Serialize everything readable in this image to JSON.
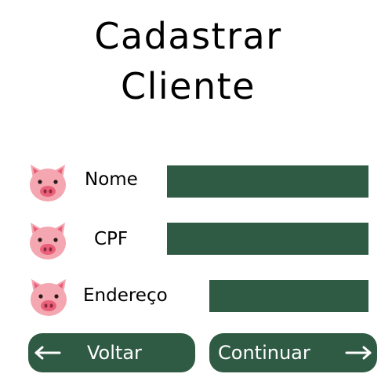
{
  "header": {
    "title_line1": "Cadastrar",
    "title_line2": "Cliente"
  },
  "form": {
    "fields": [
      {
        "label": "Nome",
        "icon": "pig-icon",
        "value": ""
      },
      {
        "label": "CPF",
        "icon": "pig-icon",
        "value": ""
      },
      {
        "label": "Endereço",
        "icon": "pig-icon",
        "value": ""
      }
    ]
  },
  "actions": {
    "back_label": "Voltar",
    "back_icon": "arrow-left-icon",
    "continue_label": "Continuar",
    "continue_icon": "arrow-right-icon"
  },
  "colors": {
    "accent": "#2f5a44",
    "pig_pink": "#f4a7b1",
    "pig_snout": "#e8607a"
  }
}
